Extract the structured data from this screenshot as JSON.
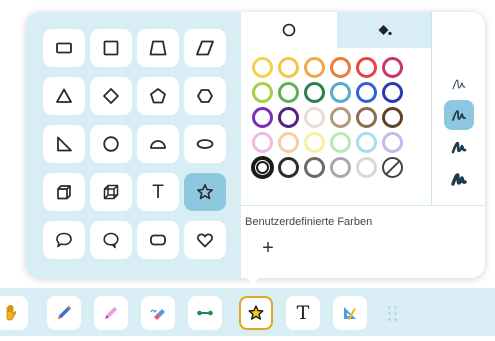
{
  "shape_panel": {
    "shapes": [
      {
        "name": "rectangle",
        "icon": "rectangle-icon"
      },
      {
        "name": "square",
        "icon": "square-icon"
      },
      {
        "name": "trapezoid",
        "icon": "trapezoid-icon"
      },
      {
        "name": "parallelogram",
        "icon": "parallelogram-icon"
      },
      {
        "name": "triangle",
        "icon": "triangle-icon"
      },
      {
        "name": "diamond",
        "icon": "diamond-icon"
      },
      {
        "name": "pentagon",
        "icon": "pentagon-icon"
      },
      {
        "name": "hexagon",
        "icon": "hexagon-icon"
      },
      {
        "name": "right-triangle",
        "icon": "right-triangle-icon"
      },
      {
        "name": "circle",
        "icon": "circle-icon"
      },
      {
        "name": "semicircle",
        "icon": "semicircle-icon"
      },
      {
        "name": "ellipse",
        "icon": "ellipse-icon"
      },
      {
        "name": "cube",
        "icon": "cube-icon"
      },
      {
        "name": "cuboid",
        "icon": "cuboid-icon"
      },
      {
        "name": "text",
        "icon": "text-icon",
        "glyph": "T"
      },
      {
        "name": "star",
        "icon": "star-icon",
        "selected": true
      },
      {
        "name": "speech-bubble-round",
        "icon": "speech-bubble-icon"
      },
      {
        "name": "speech-bubble-tail",
        "icon": "thought-bubble-icon"
      },
      {
        "name": "rounded-rectangle",
        "icon": "rounded-rectangle-icon"
      },
      {
        "name": "heart",
        "icon": "heart-icon"
      }
    ]
  },
  "color_panel": {
    "tabs": [
      {
        "name": "stroke-color",
        "icon": "circle-outline-icon",
        "active": true
      },
      {
        "name": "fill-color",
        "icon": "paint-bucket-icon",
        "active": false
      }
    ],
    "swatch_rows": [
      [
        "#f2d24e",
        "#f4c34a",
        "#eea84a",
        "#ec7b3a",
        "#e8453c",
        "#c8386a"
      ],
      [
        "#a7cf48",
        "#5ab34d",
        "#2e7d4f",
        "#57a9cf",
        "#2f63d6",
        "#2a38b0"
      ],
      [
        "#7a2fb4",
        "#54227f",
        "#eaded2",
        "#b09a80",
        "#8c6d4d",
        "#5e4329"
      ],
      [
        "#f0b8e6",
        "#f3cfa8",
        "#f7f0a0",
        "#b9e8b4",
        "#a8dcef",
        "#c9b6ec"
      ],
      [
        "#1b1b1b",
        "#2d2d2d",
        "#6a6a6a",
        "#a8a8a8",
        "#d8d8d8",
        "none"
      ]
    ],
    "selected_swatch": "#1b1b1b",
    "custom_colors_label": "Benutzerdefinierte Farben",
    "add_label": "+",
    "stroke_widths": [
      {
        "name": "thin",
        "icon": "pen-thin-icon",
        "selected": false
      },
      {
        "name": "medium",
        "icon": "pen-medium-icon",
        "selected": true
      },
      {
        "name": "thick",
        "icon": "pen-thick-icon",
        "selected": false
      },
      {
        "name": "extra-thick",
        "icon": "pen-extra-thick-icon",
        "selected": false
      }
    ]
  },
  "toolbar": {
    "tools": [
      {
        "name": "hand",
        "icon": "hand-icon"
      },
      {
        "name": "pen",
        "icon": "pen-icon"
      },
      {
        "name": "highlighter",
        "icon": "highlighter-icon"
      },
      {
        "name": "eraser",
        "icon": "eraser-icon"
      },
      {
        "name": "connector",
        "icon": "connector-icon"
      },
      {
        "name": "shapes",
        "icon": "star-icon",
        "selected": true
      },
      {
        "name": "text",
        "icon": "text-icon",
        "glyph": "T"
      },
      {
        "name": "geometry",
        "icon": "ruler-triangle-icon"
      }
    ],
    "colors": {
      "selected_border": "#e0a820",
      "accent": "#8ec8e0",
      "panel": "#d9edf5"
    }
  }
}
